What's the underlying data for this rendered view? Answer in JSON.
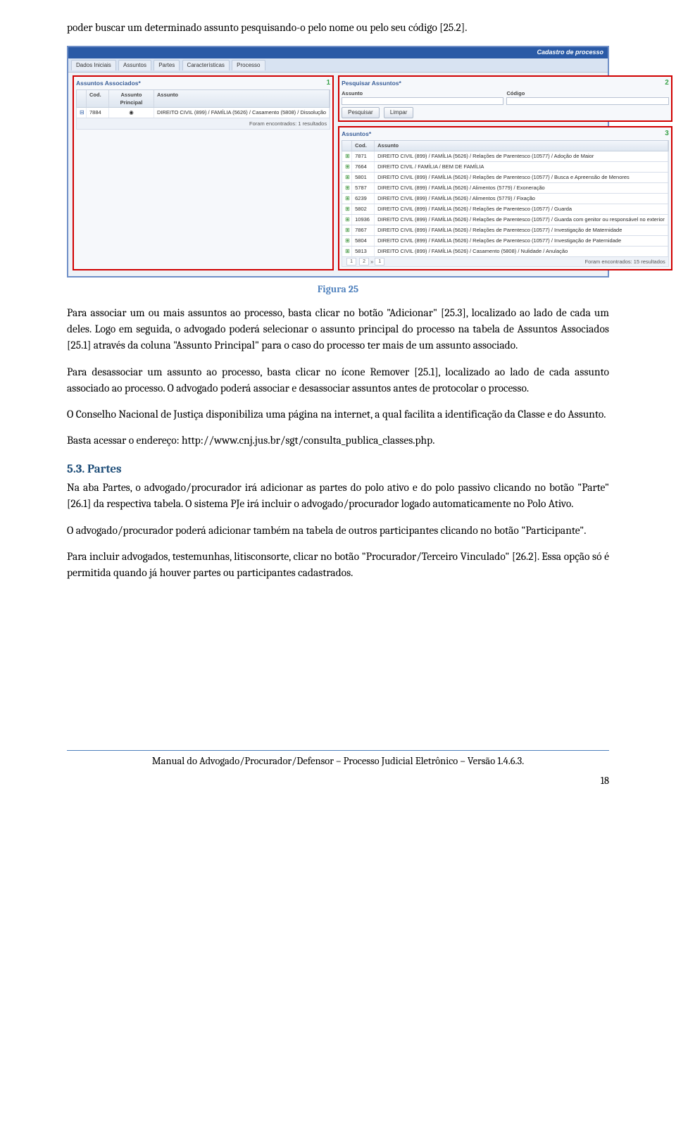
{
  "lead_paragraph": "poder buscar um determinado assunto pesquisando-o pelo nome ou pelo seu código [25.2].",
  "figure": {
    "caption": "Figura 25",
    "header_title": "Cadastro de processo",
    "tabs": [
      "Dados Iniciais",
      "Assuntos",
      "Partes",
      "Características",
      "Processo"
    ],
    "left": {
      "badge": "1",
      "title": "Assuntos Associados*",
      "th": {
        "cod": "Cod.",
        "ap": "Assunto Principal",
        "ass": "Assunto"
      },
      "row": {
        "cod": "7884",
        "ap": "◉",
        "ass": "DIREITO CIVIL (899) / FAMÍLIA (5626) / Casamento (5808) / Dissolução"
      },
      "footer": "Foram encontrados: 1 resultados"
    },
    "search": {
      "badge": "2",
      "title": "Pesquisar Assuntos*",
      "lbl_assunto": "Assunto",
      "lbl_codigo": "Código",
      "btn_pesquisar": "Pesquisar",
      "btn_limpar": "Limpar"
    },
    "results": {
      "badge": "3",
      "title": "Assuntos*",
      "th": {
        "cod": "Cod.",
        "ass": "Assunto"
      },
      "rows": [
        {
          "cod": "7871",
          "ass": "DIREITO CIVIL (899) / FAMÍLIA (5626) / Relações de Parentesco (10577) / Adoção de Maior"
        },
        {
          "cod": "7664",
          "ass": "DIREITO CIVIL / FAMÍLIA / BEM DE FAMÍLIA"
        },
        {
          "cod": "5801",
          "ass": "DIREITO CIVIL (899) / FAMÍLIA (5626) / Relações de Parentesco (10577) / Busca e Apreensão de Menores"
        },
        {
          "cod": "5787",
          "ass": "DIREITO CIVIL (899) / FAMÍLIA (5626) / Alimentos (5779) / Exoneração"
        },
        {
          "cod": "6239",
          "ass": "DIREITO CIVIL (899) / FAMÍLIA (5626) / Alimentos (5779) / Fixação"
        },
        {
          "cod": "5802",
          "ass": "DIREITO CIVIL (899) / FAMÍLIA (5626) / Relações de Parentesco (10577) / Guarda"
        },
        {
          "cod": "10936",
          "ass": "DIREITO CIVIL (899) / FAMÍLIA (5626) / Relações de Parentesco (10577) / Guarda com genitor ou responsável no exterior"
        },
        {
          "cod": "7867",
          "ass": "DIREITO CIVIL (899) / FAMÍLIA (5626) / Relações de Parentesco (10577) / Investigação de Maternidade"
        },
        {
          "cod": "5804",
          "ass": "DIREITO CIVIL (899) / FAMÍLIA (5626) / Relações de Parentesco (10577) / Investigação de Paternidade"
        },
        {
          "cod": "5813",
          "ass": "DIREITO CIVIL (899) / FAMÍLIA (5626) / Casamento (5808) / Nulidade / Anulação"
        }
      ],
      "pager": {
        "p1": "1",
        "p2": "2",
        "box": "1",
        "msg": "Foram encontrados: 15 resultados"
      }
    }
  },
  "paragraphs": {
    "p2": "Para associar um ou mais assuntos ao processo, basta clicar no botão \"Adicionar\" [25.3], localizado ao lado de cada um deles. Logo em seguida, o advogado poderá selecionar o assunto principal do processo na tabela de Assuntos Associados [25.1] através da coluna \"Assunto Principal\" para o caso do processo ter mais de um assunto associado.",
    "p3": "Para desassociar um assunto ao processo, basta clicar no ícone Remover [25.1], localizado ao lado de cada assunto associado ao processo. O advogado poderá associar e desassociar assuntos antes de protocolar o processo.",
    "p4": "O Conselho Nacional de Justiça disponibiliza uma página na internet, a qual facilita a identificação da Classe e do Assunto.",
    "p5": "Basta acessar o endereço: http://www.cnj.jus.br/sgt/consulta_publica_classes.php."
  },
  "section": {
    "heading": "5.3. Partes",
    "p6": "Na aba Partes, o advogado/procurador irá adicionar as partes do polo ativo e do polo passivo clicando no botão \"Parte\" [26.1] da respectiva tabela. O sistema PJe irá incluir o advogado/procurador logado automaticamente no Polo Ativo.",
    "p7": "O advogado/procurador poderá adicionar também na tabela de outros participantes clicando no botão \"Participante\".",
    "p8": "Para incluir advogados, testemunhas, litisconsorte, clicar no botão \"Procurador/Terceiro Vinculado\" [26.2]. Essa opção só é permitida quando já houver partes ou participantes cadastrados."
  },
  "footer": {
    "text": "Manual do Advogado/Procurador/Defensor – Processo Judicial Eletrônico – Versão 1.4.6.3.",
    "page": "18"
  }
}
